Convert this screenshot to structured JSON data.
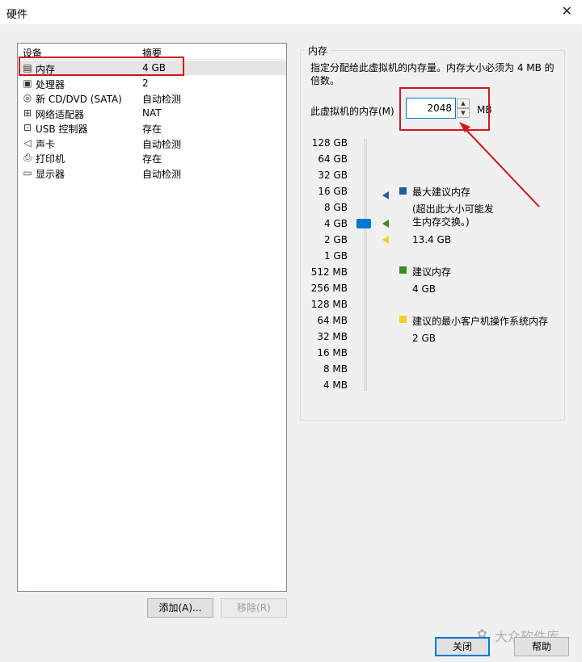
{
  "window": {
    "title": "硬件"
  },
  "device_list": {
    "headers": {
      "device": "设备",
      "summary": "摘要"
    },
    "items": [
      {
        "name": "内存",
        "summary": "4 GB",
        "icon": "memory-icon"
      },
      {
        "name": "处理器",
        "summary": "2",
        "icon": "processor-icon"
      },
      {
        "name": "新 CD/DVD (SATA)",
        "summary": "自动检测",
        "icon": "cd-dvd-icon"
      },
      {
        "name": "网络适配器",
        "summary": "NAT",
        "icon": "network-adapter-icon"
      },
      {
        "name": "USB 控制器",
        "summary": "存在",
        "icon": "usb-icon"
      },
      {
        "name": "声卡",
        "summary": "自动检测",
        "icon": "sound-card-icon"
      },
      {
        "name": "打印机",
        "summary": "存在",
        "icon": "printer-icon"
      },
      {
        "name": "显示器",
        "summary": "自动检测",
        "icon": "display-icon"
      }
    ],
    "selected": "内存"
  },
  "buttons": {
    "add": "添加(A)...",
    "remove": "移除(R)",
    "close": "关闭",
    "help": "帮助"
  },
  "memory": {
    "group_title": "内存",
    "description": "指定分配给此虚拟机的内存量。内存大小必须为 4 MB 的倍数。",
    "field_label": "此虚拟机的内存(M)",
    "value": "2048",
    "unit": "MB",
    "ticks": [
      "128 GB",
      "64 GB",
      "32 GB",
      "16 GB",
      "8 GB",
      "4 GB",
      "2 GB",
      "1 GB",
      "512 MB",
      "256 MB",
      "128 MB",
      "64 MB",
      "32 MB",
      "16 MB",
      "8 MB",
      "4 MB"
    ],
    "legend": {
      "max_title": "最大建议内存",
      "max_note": "(超出此大小可能发生内存交换。)",
      "max_value": "13.4 GB",
      "rec_title": "建议内存",
      "rec_value": "4 GB",
      "min_title": "建议的最小客户机操作系统内存",
      "min_value": "2 GB"
    },
    "colors": {
      "max": "#1f5fa0",
      "recommended": "#3b8a22",
      "minimum": "#f2d21b",
      "thumb": "#0078d7"
    }
  },
  "watermark": "大众软件库"
}
